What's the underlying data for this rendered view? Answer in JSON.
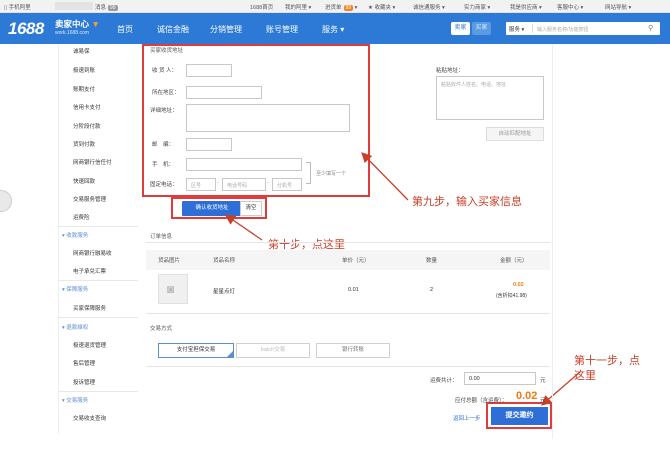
{
  "topbar": {
    "mobile": "手机阿里",
    "messages": "消息",
    "messages_count": "99",
    "home": "1688首页",
    "my_ali": "我的阿里",
    "purchase": "进货单",
    "purchase_count": "99",
    "favorites": "收藏夹",
    "trust": "诚信通服务",
    "strength": "实力商家",
    "supplier": "我是供应商",
    "customer": "客服中心",
    "sitemap": "网站导航"
  },
  "nav": {
    "logo_num": "1688",
    "logo_title": "卖家中心",
    "logo_sub": "work.1688.com",
    "items": [
      "首页",
      "诚信金融",
      "分销管理",
      "账号管理",
      "服务"
    ],
    "seller_btn": "卖家",
    "buyer_btn": "买家",
    "search_scope": "服务",
    "search_placeholder": "输入服务名称/功能按钮"
  },
  "sidebar": {
    "items_a": [
      "诚易保",
      "极速到账",
      "账期支付",
      "信用卡支付",
      "分阶段付款",
      "货到付款",
      "网商银行信任付",
      "快速回款",
      "交易服务管理",
      "运费险"
    ],
    "group_collect": "收款服务",
    "items_b": [
      "网商银行融易收",
      "电子承兑汇票"
    ],
    "group_guarantee": "保障服务",
    "items_c": [
      "买家保障服务"
    ],
    "group_refund": "退款维权",
    "items_d": [
      "极速退货管理",
      "售后管理",
      "投诉管理"
    ],
    "group_report": "交易服务",
    "items_e": [
      "交易收支查询"
    ]
  },
  "address_form": {
    "title": "买家收货地址",
    "receiver_label": "收 货 人：",
    "region_label": "所在地区：",
    "detail_label": "详细地址：",
    "zip_label": "邮　编：",
    "phone_label": "手　机：",
    "tel_label": "固定电话：",
    "tel_area": "区号",
    "tel_number": "电话号码",
    "tel_ext": "分机号",
    "hint": "至少填写一个",
    "confirm_button": "确认收货地址",
    "clear_button": "清空",
    "paste_label": "粘贴地址：",
    "paste_placeholder": "粘贴收件人姓名、电话、地址",
    "auto_match_button": "自动匹配地址"
  },
  "order": {
    "title": "订单信息",
    "headers": [
      "货品图片",
      "货品名称",
      "单价（元）",
      "数量",
      "金额（元）"
    ],
    "rows": [
      {
        "name": "星星点灯",
        "price": "0.01",
        "qty": "2",
        "amount": "0.02",
        "discount": "(含折扣41.98)"
      }
    ]
  },
  "payment": {
    "title": "交易方式",
    "options": [
      "支付宝担保交易",
      "batch交易",
      "银行转账"
    ]
  },
  "summary": {
    "shipping_label": "运费共计：",
    "shipping_value": "0.00",
    "shipping_unit": "元",
    "total_label": "应付总额（含运费）：",
    "total_value": "0.02",
    "total_unit": "元",
    "back_link": "返回上一步",
    "submit_button": "提交邀约"
  },
  "annotations": {
    "step9": "第九步，输入买家信息",
    "step10": "第十步，点这里",
    "step11": "第十一步，点这里"
  },
  "colors": {
    "nav_blue": "#2c7ad6",
    "primary_blue": "#2d6fd6",
    "annotation_red": "#e23b3b",
    "price_orange": "#f07a0f"
  }
}
